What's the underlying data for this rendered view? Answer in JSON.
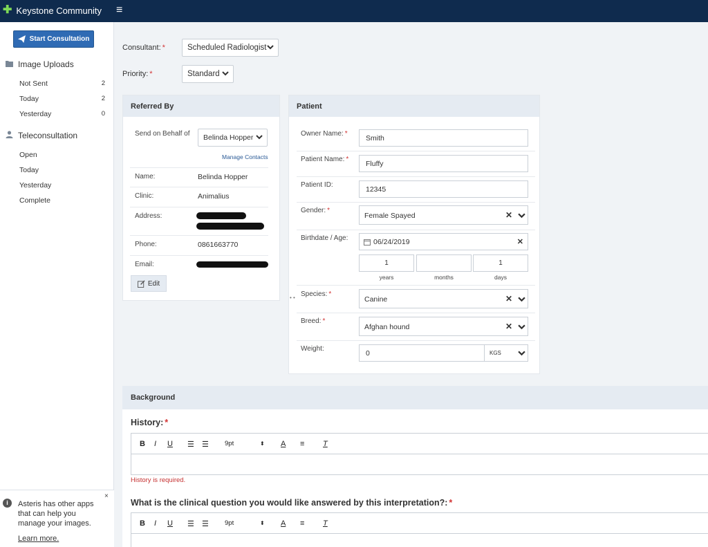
{
  "app": {
    "title": "Keystone Community",
    "logo_icon": "keystone-logo-icon",
    "menu_icon": "hamburger-icon"
  },
  "sidebar": {
    "start_button": "Start Consultation",
    "image_uploads": {
      "label": "Image Uploads",
      "items": [
        {
          "label": "Not Sent",
          "count": "2"
        },
        {
          "label": "Today",
          "count": "2"
        },
        {
          "label": "Yesterday",
          "count": "0"
        }
      ]
    },
    "teleconsultation": {
      "label": "Teleconsultation",
      "items": [
        {
          "label": "Open"
        },
        {
          "label": "Today"
        },
        {
          "label": "Yesterday"
        },
        {
          "label": "Complete"
        }
      ]
    },
    "info": {
      "text": "Asteris has other apps that can help you manage your images.",
      "link": "Learn more.",
      "close": "×"
    }
  },
  "form": {
    "consultant": {
      "label": "Consultant:",
      "required": "*",
      "value": "Scheduled Radiologist"
    },
    "priority": {
      "label": "Priority:",
      "required": "*",
      "value": "Standard"
    }
  },
  "referred_by": {
    "title": "Referred By",
    "send_label": "Send on Behalf of",
    "send_value": "Belinda Hopper",
    "manage_contacts": "Manage Contacts",
    "fields": {
      "name": {
        "label": "Name:",
        "value": "Belinda Hopper"
      },
      "clinic": {
        "label": "Clinic:",
        "value": "Animalius"
      },
      "address": {
        "label": "Address:"
      },
      "phone": {
        "label": "Phone:",
        "value": "0861663770"
      },
      "email": {
        "label": "Email:"
      }
    },
    "edit_button": "Edit"
  },
  "patient": {
    "title": "Patient",
    "owner_name": {
      "label": "Owner Name:",
      "required": "*",
      "value": "Smith"
    },
    "patient_name": {
      "label": "Patient Name:",
      "required": "*",
      "value": "Fluffy"
    },
    "patient_id": {
      "label": "Patient ID:",
      "value": "12345"
    },
    "gender": {
      "label": "Gender:",
      "required": "*",
      "value": "Female Spayed"
    },
    "birthdate": {
      "label": "Birthdate / Age:",
      "value": "06/24/2019"
    },
    "age": {
      "years": {
        "value": "1",
        "caption": "years"
      },
      "months": {
        "value": "",
        "caption": "months"
      },
      "days": {
        "value": "1",
        "caption": "days"
      }
    },
    "species": {
      "label": "Species:",
      "required": "*",
      "value": "Canine"
    },
    "breed": {
      "label": "Breed:",
      "required": "*",
      "value": "Afghan hound"
    },
    "weight": {
      "label": "Weight:",
      "value": "0",
      "unit": "KGS"
    }
  },
  "background": {
    "title": "Background",
    "history": {
      "label": "History:",
      "required": "*",
      "error": "History is required."
    },
    "question": {
      "label": "What is the clinical question you would like answered by this interpretation?:",
      "required": "*"
    },
    "toolbar": {
      "bold": "B",
      "italic": "I",
      "underline": "U",
      "font_size": "9pt"
    }
  },
  "colors": {
    "topbar": "#0f2b4e",
    "primary_button": "#2f6bb4",
    "panel_header": "#e5ebf2",
    "required": "#d23434"
  }
}
